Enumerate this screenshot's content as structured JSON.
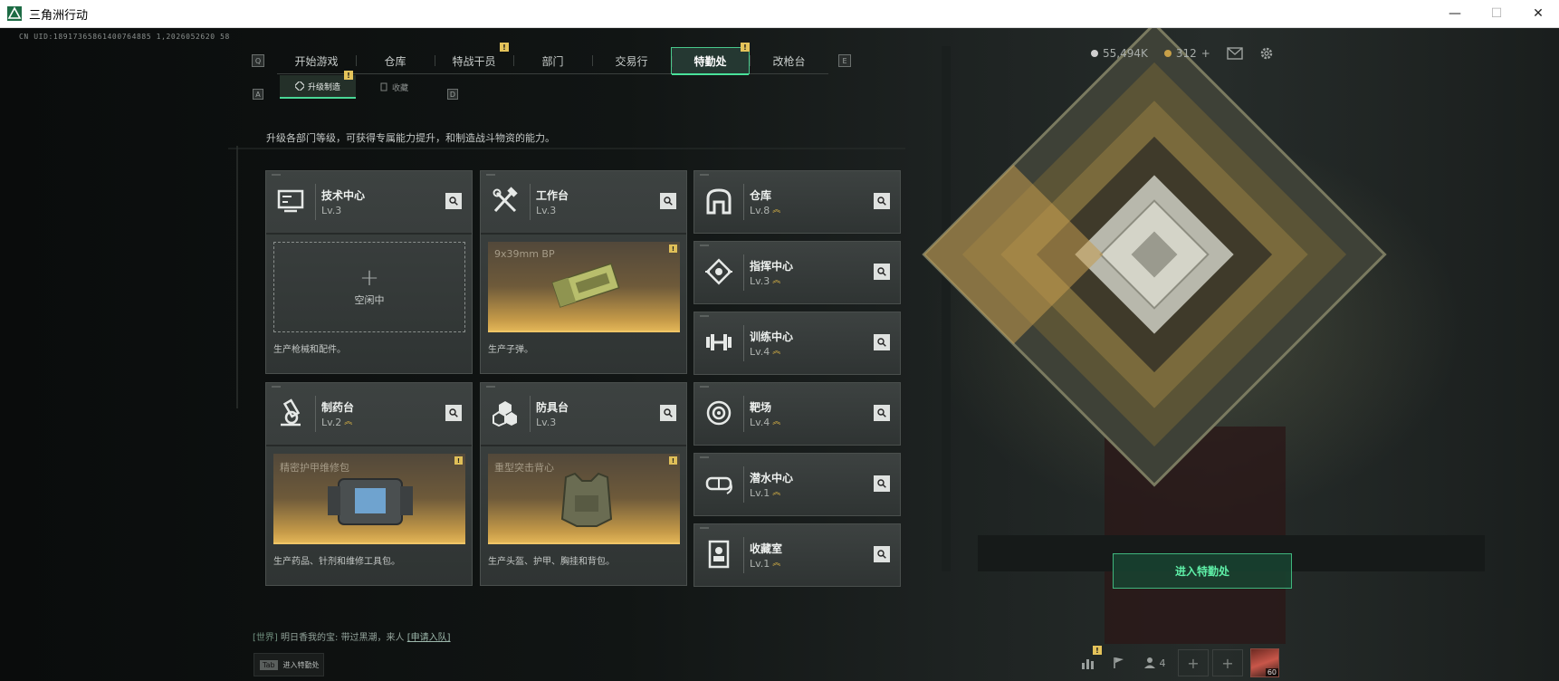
{
  "window": {
    "title": "三角洲行动",
    "minimize": "—",
    "maximize": "☐",
    "close": "✕"
  },
  "uid": "CN UID:18917365861400764885 1,2026052620 58",
  "keyhints": {
    "nav_left": "Q",
    "nav_right": "E",
    "sub_left": "A",
    "sub_right": "D"
  },
  "topnav": {
    "tabs": [
      {
        "label": "开始游戏",
        "active": false,
        "badge": false
      },
      {
        "label": "仓库",
        "active": false,
        "badge": false
      },
      {
        "label": "特战干员",
        "active": false,
        "badge": true
      },
      {
        "label": "部门",
        "active": false,
        "badge": false
      },
      {
        "label": "交易行",
        "active": false,
        "badge": false
      },
      {
        "label": "特勤处",
        "active": true,
        "badge": true
      },
      {
        "label": "改枪台",
        "active": false,
        "badge": false
      }
    ],
    "badge_text": "!"
  },
  "subnav": {
    "tabs": [
      {
        "label": "升级制造",
        "active": true
      },
      {
        "label": "收藏",
        "active": false
      }
    ]
  },
  "currency": {
    "coins": "55,494K",
    "tokens": "312",
    "add": "+"
  },
  "description": "升级各部门等级，可获得专属能力提升，和制造战斗物资的能力。",
  "departments_big": [
    {
      "name": "技术中心",
      "level": "Lv.3",
      "upgrade": false,
      "icon": "tech-center-icon",
      "state": "idle",
      "slot_label": "空闲中",
      "plus": "+",
      "product": "",
      "footer": "生产枪械和配件。"
    },
    {
      "name": "工作台",
      "level": "Lv.3",
      "upgrade": false,
      "icon": "workbench-icon",
      "state": "producing",
      "slot_label": "",
      "plus": "",
      "product": "9x39mm BP",
      "footer": "生产子弹。"
    },
    {
      "name": "制药台",
      "level": "Lv.2",
      "upgrade": true,
      "icon": "pharmacy-icon",
      "state": "producing",
      "slot_label": "",
      "plus": "",
      "product": "精密护甲维修包",
      "footer": "生产药品、针剂和维修工具包。"
    },
    {
      "name": "防具台",
      "level": "Lv.3",
      "upgrade": false,
      "icon": "armor-bench-icon",
      "state": "producing",
      "slot_label": "",
      "plus": "",
      "product": "重型突击背心",
      "footer": "生产头盔、护甲、胸挂和背包。"
    }
  ],
  "departments_small": [
    {
      "name": "仓库",
      "level": "Lv.8",
      "upgrade": true,
      "icon": "storage-icon"
    },
    {
      "name": "指挥中心",
      "level": "Lv.3",
      "upgrade": true,
      "icon": "command-center-icon"
    },
    {
      "name": "训练中心",
      "level": "Lv.4",
      "upgrade": true,
      "icon": "training-center-icon"
    },
    {
      "name": "靶场",
      "level": "Lv.4",
      "upgrade": true,
      "icon": "shooting-range-icon"
    },
    {
      "name": "潜水中心",
      "level": "Lv.1",
      "upgrade": true,
      "icon": "diving-center-icon"
    },
    {
      "name": "收藏室",
      "level": "Lv.1",
      "upgrade": true,
      "icon": "collection-room-icon"
    }
  ],
  "upgrade_glyph": "︽",
  "enter_button": "进入特勤处",
  "chat": {
    "channel": "[世界]",
    "sender": "明日香我的宝:",
    "message": "带过黑潮，来人",
    "link": "[申请入队]"
  },
  "tab_hint": {
    "key": "Tab",
    "label": "进入特勤处"
  },
  "bottombar": {
    "players": "4",
    "avatar_level": "60"
  },
  "colors": {
    "accent": "#49c98c",
    "badge": "#e4c35a",
    "upgrade": "#e0b845"
  }
}
